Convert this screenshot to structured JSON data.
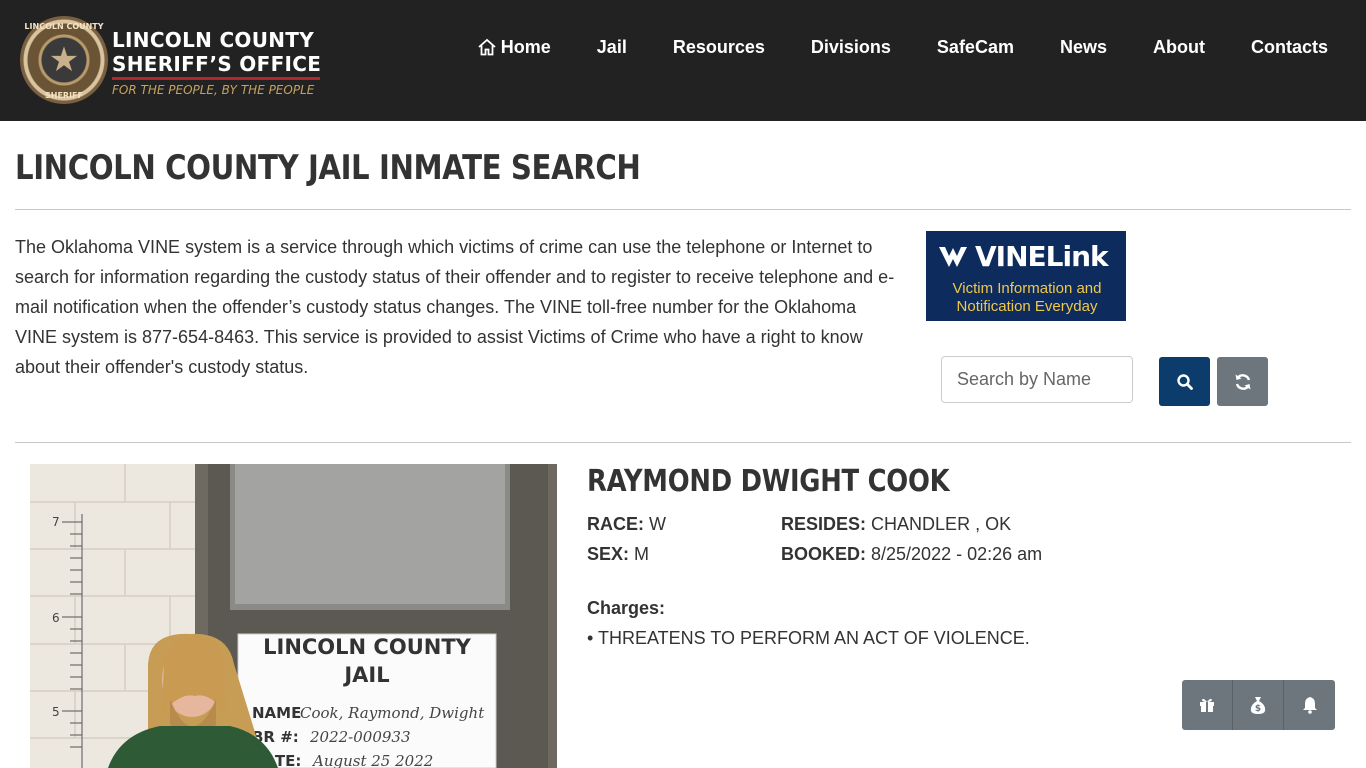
{
  "header": {
    "brand_line1": "LINCOLN COUNTY",
    "brand_line2": "SHERIFF’S OFFICE",
    "tagline": "FOR THE PEOPLE, BY THE PEOPLE",
    "badge_top": "LINCOLN COUNTY",
    "badge_bottom": "SHERIFF",
    "nav": [
      {
        "label": "Home",
        "icon": "home-icon"
      },
      {
        "label": "Jail"
      },
      {
        "label": "Resources"
      },
      {
        "label": "Divisions"
      },
      {
        "label": "SafeCam"
      },
      {
        "label": "News"
      },
      {
        "label": "About"
      },
      {
        "label": "Contacts"
      }
    ]
  },
  "page": {
    "title": "LINCOLN COUNTY JAIL INMATE SEARCH",
    "intro": "The Oklahoma VINE system is a service through which victims of crime can use the telephone or Internet to search for information regarding the custody status of their offender and to register to receive telephone and e-mail notification when the offender’s custody status changes. The VINE toll-free number for the Oklahoma VINE system is 877-654-8463. This service is provided to assist Victims of Crime who have a right to know about their offender's custody status."
  },
  "vinelink": {
    "logo_text": "VINELink",
    "subtitle_line1": "Victim Information and",
    "subtitle_line2": "Notification Everyday"
  },
  "search": {
    "placeholder": "Search by Name",
    "search_icon": "search-icon",
    "reset_icon": "refresh-icon"
  },
  "inmate": {
    "name": "RAYMOND DWIGHT COOK",
    "race_label": "RACE:",
    "race": "W",
    "sex_label": "SEX:",
    "sex": "M",
    "resides_label": "RESIDES:",
    "resides": "CHANDLER , OK",
    "booked_label": "BOOKED:",
    "booked": "8/25/2022 - 02:26 am",
    "charges_label": "Charges:",
    "charges": [
      "• THREATENS TO PERFORM AN ACT OF VIOLENCE."
    ],
    "mugshot": {
      "board_line1": "LINCOLN COUNTY",
      "board_line2": "JAIL",
      "board_name_label": "NAME",
      "board_name": "Cook, Raymond, Dwight",
      "board_br_label": "BR #:",
      "board_br": "2022-000933",
      "board_date_label": "DATE:",
      "board_date": "August 25 2022",
      "ruler_marks": [
        "7",
        "6",
        "5"
      ]
    }
  },
  "fab": [
    "gift-icon",
    "money-bag-icon",
    "bell-icon"
  ],
  "colors": {
    "header_bg": "#222222",
    "accent_red": "#b3242b",
    "tagline_gold": "#c6a25e",
    "primary_blue": "#0b3c6b",
    "secondary_gray": "#6d767d",
    "vine_blue": "#0d2b5c",
    "vine_gold": "#f0c84a"
  }
}
